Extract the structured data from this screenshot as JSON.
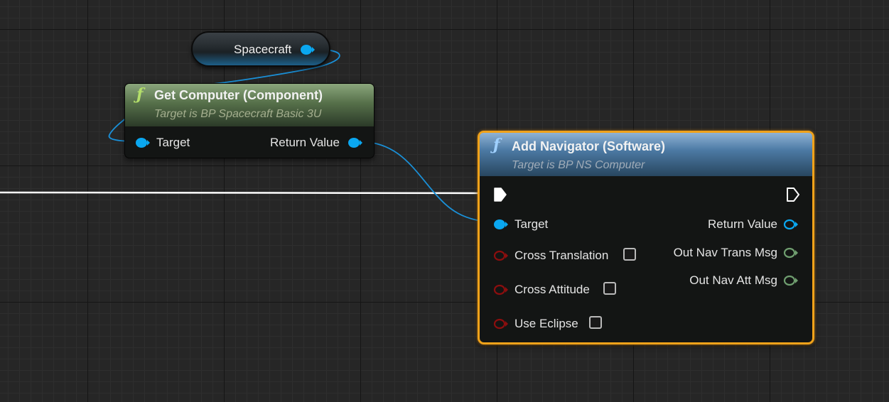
{
  "colors": {
    "object_pin": "#0aa7f0",
    "bool_pin": "#8b0e0e",
    "struct_pin": "#6f9e6f",
    "wire_object": "#1a90d8",
    "wire_exec": "#ffffff",
    "selection_outline": "#f0a21a"
  },
  "spacecraft_node": {
    "label": "Spacecraft"
  },
  "get_computer_node": {
    "icon": "function-icon",
    "icon_glyph": "ƒ",
    "title": "Get Computer (Component)",
    "subtitle": "Target is BP Spacecraft Basic 3U",
    "inputs": {
      "target": "Target"
    },
    "outputs": {
      "return_value": "Return Value"
    }
  },
  "add_navigator_node": {
    "icon": "function-icon",
    "icon_glyph": "ƒ",
    "title": "Add Navigator (Software)",
    "subtitle": "Target is BP NS Computer",
    "inputs": {
      "target": "Target",
      "cross_translation": "Cross Translation",
      "cross_attitude": "Cross Attitude",
      "use_eclipse": "Use Eclipse"
    },
    "outputs": {
      "return_value": "Return Value",
      "out_nav_trans_msg": "Out Nav Trans Msg",
      "out_nav_att_msg": "Out Nav Att Msg"
    }
  }
}
